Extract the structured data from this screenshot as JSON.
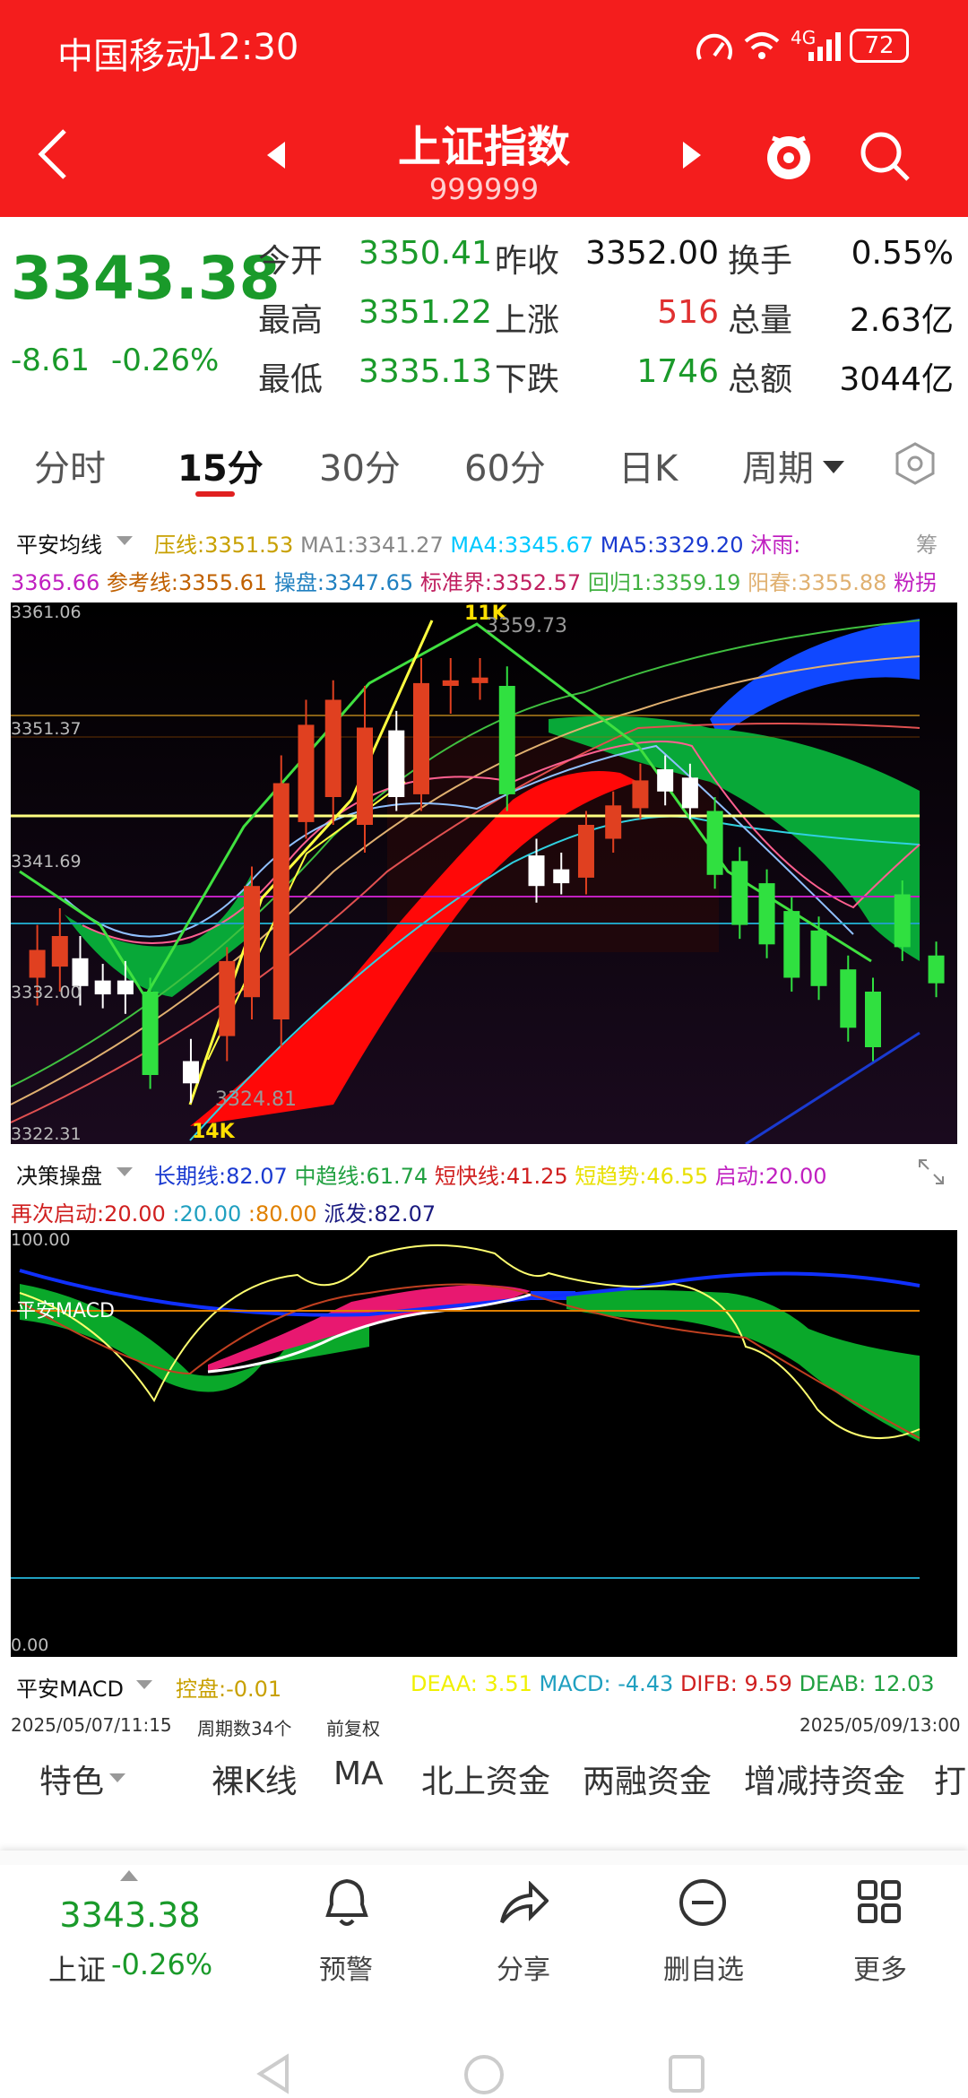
{
  "status": {
    "carrier": "中国移动",
    "time": "12:30",
    "battery": "72",
    "network": "4G"
  },
  "header": {
    "title": "上证指数",
    "code": "999999"
  },
  "quote": {
    "price": "3343.38",
    "change": "-8.61",
    "pct": "-0.26%",
    "rows": [
      {
        "l1": "今开",
        "v1": "3350.41",
        "l2": "昨收",
        "v2": "3352.00",
        "l3": "换手",
        "v3": "0.55%"
      },
      {
        "l1": "最高",
        "v1": "3351.22",
        "l2": "上涨",
        "v2": "516",
        "l3": "总量",
        "v3": "2.63亿"
      },
      {
        "l1": "最低",
        "v1": "3335.13",
        "l2": "下跌",
        "v2": "1746",
        "l3": "总额",
        "v3": "3044亿"
      }
    ]
  },
  "tabs": {
    "t1": "分时",
    "t2": "15分",
    "t3": "30分",
    "t4": "60分",
    "t5": "日K",
    "t6": "周期"
  },
  "ma": {
    "name": "平安均线",
    "items": [
      {
        "t": "压线:3351.53",
        "c": "#c8a000"
      },
      {
        "t": "MA1:3341.27",
        "c": "#888"
      },
      {
        "t": "MA4:3345.67",
        "c": "#00c8ff"
      },
      {
        "t": "MA5:3329.20",
        "c": "#1a3ad0"
      },
      {
        "t": "沐雨:",
        "c": "#c020c0"
      },
      {
        "t": "3365.66",
        "c": "#c020c0"
      },
      {
        "t": "参考线:3355.61",
        "c": "#c06000"
      },
      {
        "t": "操盘:3347.65",
        "c": "#2080c0"
      },
      {
        "t": "标准界:3352.57",
        "c": "#c02060"
      },
      {
        "t": "回归1:3359.19",
        "c": "#40b040"
      },
      {
        "t": "阳春:3355.88",
        "c": "#e0b070"
      },
      {
        "t": "粉拐",
        "c": "#c020c0"
      }
    ],
    "extra": "筹"
  },
  "k": {
    "y1": "3361.06",
    "y2": "3351.37",
    "y3": "3341.69",
    "y4": "3332.00",
    "y5": "3322.31",
    "hi": "11K",
    "hiv": "3359.73",
    "lo": "14K",
    "lov": "3324.81"
  },
  "jc": {
    "name": "决策操盘",
    "items": [
      {
        "t": "长期线:82.07",
        "c": "#1a3ad0"
      },
      {
        "t": "中趋线:61.74",
        "c": "#20a040"
      },
      {
        "t": "短快线:41.25",
        "c": "#d02020"
      },
      {
        "t": "短趋势:46.55",
        "c": "#e0e000"
      },
      {
        "t": "启动:20.00",
        "c": "#c020c0"
      }
    ],
    "items2": [
      {
        "t": "再次启动:20.00",
        "c": "#d02020"
      },
      {
        "t": ":20.00",
        "c": "#20a0c0"
      },
      {
        "t": ":80.00",
        "c": "#e08000"
      },
      {
        "t": "派发:82.07",
        "c": "#1a1a80"
      }
    ],
    "y1": "100.00",
    "y2": "0.00"
  },
  "macd": {
    "name": "平安MACD",
    "items": [
      {
        "t": "控盘:-0.01",
        "c": "#c8a000"
      },
      {
        "t": "DEAA: 3.51",
        "c": "#f0f000"
      },
      {
        "t": "MACD: -4.43",
        "c": "#20a0c0"
      },
      {
        "t": "DIFB: 9.59",
        "c": "#d02020"
      },
      {
        "t": "DEAB: 12.03",
        "c": "#20a040"
      }
    ]
  },
  "dates": {
    "start": "2025/05/07/11:15",
    "count": "周期数34个",
    "adj": "前复权",
    "end": "2025/05/09/13:00"
  },
  "features": [
    "特色",
    "裸K线",
    "MA",
    "北上资金",
    "两融资金",
    "增减持资金",
    "打"
  ],
  "bottom": {
    "price": "3343.38",
    "label": "上证",
    "pct": "-0.26%",
    "b1": "预警",
    "b2": "分享",
    "b3": "删自选",
    "b4": "更多"
  }
}
